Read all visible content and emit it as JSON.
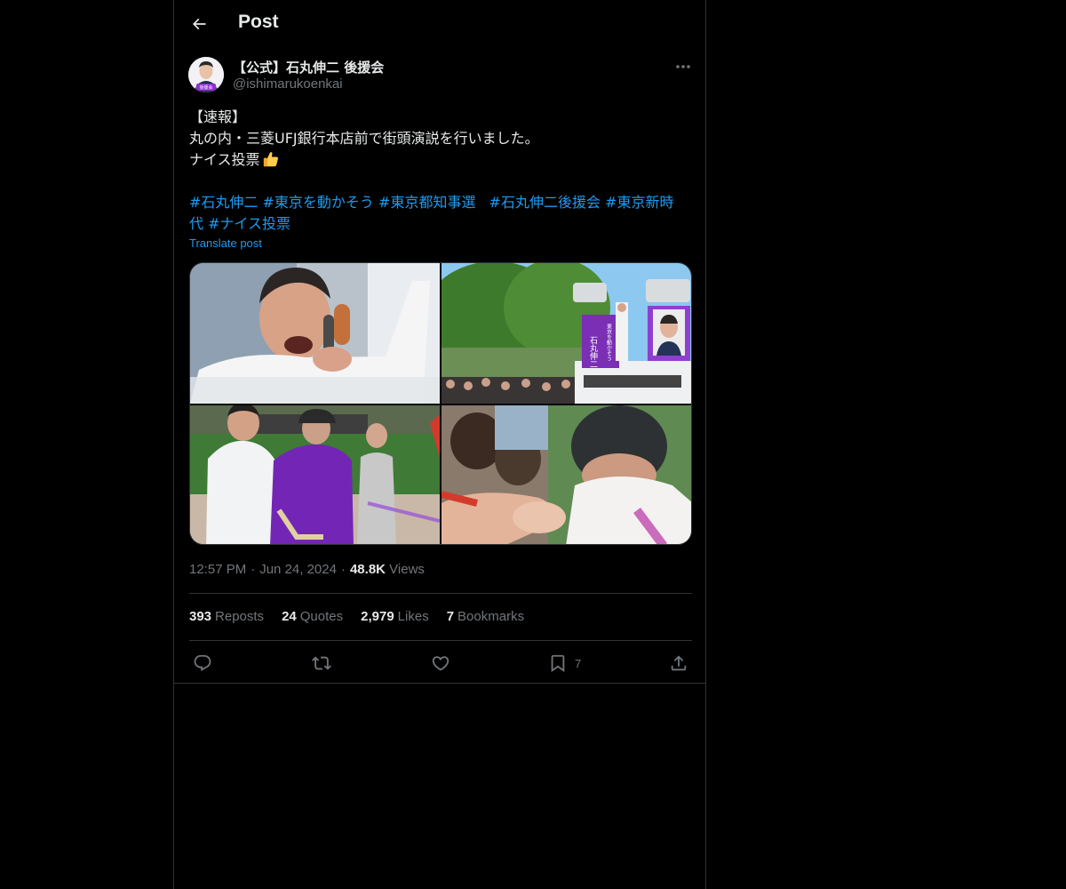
{
  "header": {
    "title": "Post",
    "back_icon": "arrow-left-icon"
  },
  "author": {
    "name": "【公式】石丸伸二 後援会",
    "handle": "@ishimarukoenkai",
    "avatar_badge": "後援会"
  },
  "post": {
    "lines": [
      "【速報】",
      "丸の内・三菱UFJ銀行本店前で街頭演説を行いました。",
      "ナイス投票"
    ],
    "hashtags_line1": [
      "#石丸伸二",
      "#東京を動かそう",
      "#東京都知事選",
      "#石丸伸二後援会",
      "#東京新時"
    ],
    "hashtags_line2": [
      "代",
      "#ナイス投票"
    ],
    "translate": "Translate post",
    "media_labels": [
      "石丸伸二",
      "東京を動かそう"
    ]
  },
  "meta": {
    "time": "12:57 PM",
    "date": "Jun 24, 2024",
    "views_count": "48.8K",
    "views_label": "Views"
  },
  "stats": [
    {
      "num": "393",
      "label": "Reposts"
    },
    {
      "num": "24",
      "label": "Quotes"
    },
    {
      "num": "2,979",
      "label": "Likes"
    },
    {
      "num": "7",
      "label": "Bookmarks"
    }
  ],
  "actions": {
    "bookmark_count": "7"
  },
  "colors": {
    "accent": "#1d9bf0",
    "muted": "#71767b",
    "text": "#e7e9ea",
    "border": "#2f3336",
    "brand_purple": "#7a2fb5"
  }
}
